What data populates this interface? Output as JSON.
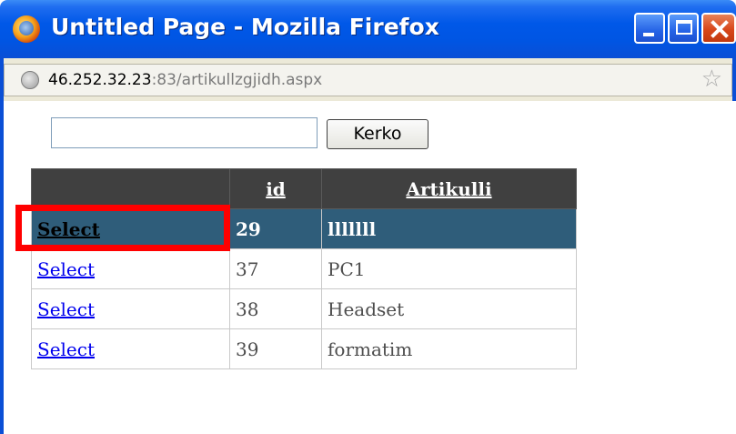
{
  "window": {
    "title": "Untitled Page - Mozilla Firefox"
  },
  "addressbar": {
    "url_host": "46.252.32.23",
    "url_rest": ":83/artikullzgjidh.aspx"
  },
  "search": {
    "value": "",
    "button_label": "Kerko"
  },
  "grid": {
    "headers": [
      "",
      "id",
      "Artikulli"
    ],
    "rows": [
      {
        "action": "Select",
        "id": "29",
        "artikulli": "lllllll",
        "selected": true
      },
      {
        "action": "Select",
        "id": "37",
        "artikulli": "PC1",
        "selected": false
      },
      {
        "action": "Select",
        "id": "38",
        "artikulli": "Headset",
        "selected": false
      },
      {
        "action": "Select",
        "id": "39",
        "artikulli": "formatim",
        "selected": false
      }
    ]
  },
  "colors": {
    "header_bg": "#404040",
    "selected_row_bg": "#2f5d7a",
    "highlight_border": "#ff0000",
    "titlebar": "#0058e8"
  },
  "icons": [
    "firefox-icon",
    "minimize-icon",
    "maximize-icon",
    "close-icon",
    "globe-icon",
    "star-icon"
  ]
}
